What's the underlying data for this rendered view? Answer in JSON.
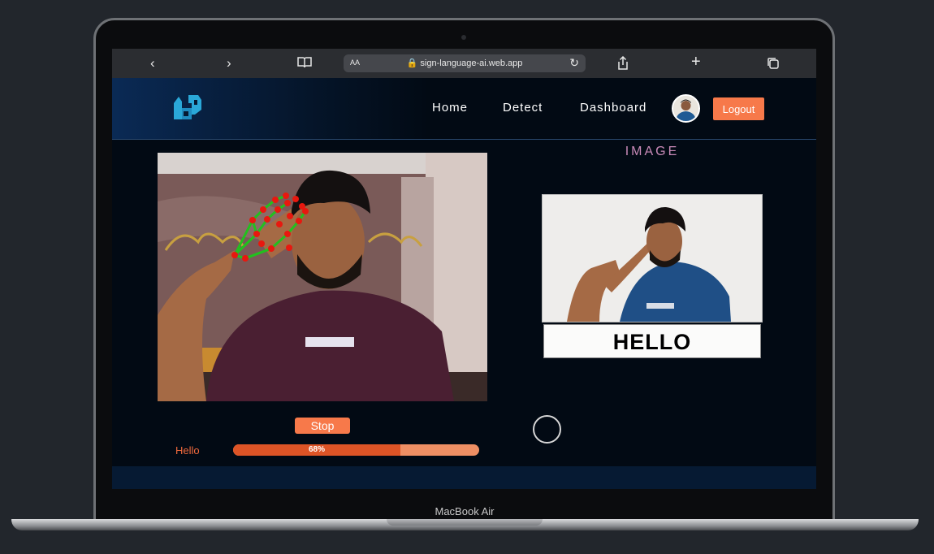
{
  "device": {
    "label": "MacBook Air"
  },
  "browser": {
    "text_size": "AA",
    "url": "sign-language-ai.web.app",
    "icons": [
      "chevron-left-icon",
      "chevron-right-icon",
      "book-icon",
      "reload-icon",
      "share-icon",
      "plus-icon",
      "tabs-icon"
    ]
  },
  "nav": {
    "links": [
      "Home",
      "Detect",
      "Dashboard"
    ],
    "logout_label": "Logout"
  },
  "panel": {
    "title": "IMAGE",
    "caption": "HELLO"
  },
  "controls": {
    "stop_label": "Stop",
    "prediction_label": "Hello",
    "confidence": 68,
    "confidence_text": "68%"
  },
  "colors": {
    "accent": "#f7794a",
    "progress_fill": "#dd5426",
    "progress_track": "#ee8f64",
    "title": "#c98ab8",
    "background": "#020a14"
  }
}
